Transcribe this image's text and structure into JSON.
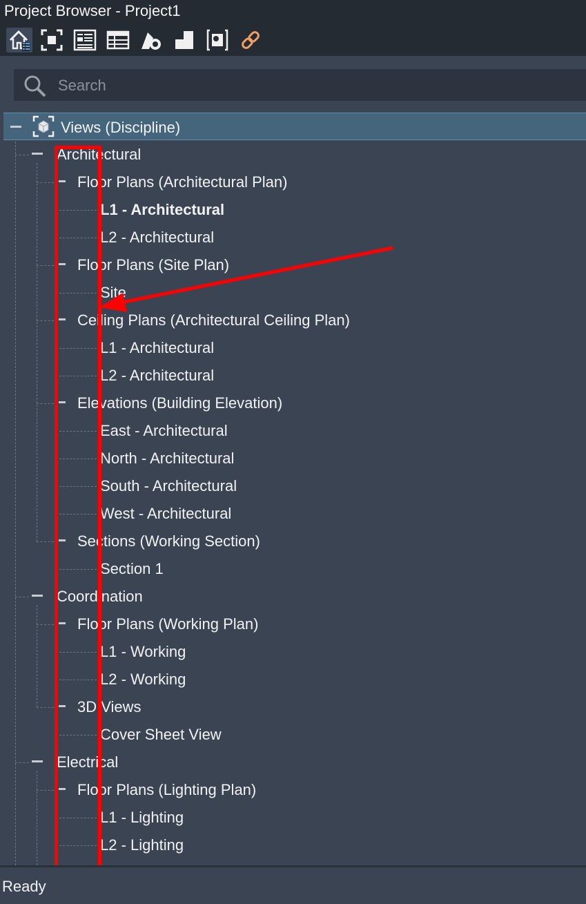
{
  "window": {
    "title": "Project Browser - Project1"
  },
  "toolbar": {
    "buttons": [
      {
        "icon": "home-icon"
      },
      {
        "icon": "views-icon"
      },
      {
        "icon": "sheets-icon"
      },
      {
        "icon": "schedules-icon"
      },
      {
        "icon": "families-icon"
      },
      {
        "icon": "groups-icon"
      },
      {
        "icon": "revit-links-icon"
      },
      {
        "icon": "link-icon"
      }
    ]
  },
  "search": {
    "placeholder": "Search",
    "value": ""
  },
  "tree": {
    "root": "Views (Discipline)",
    "disciplines": [
      {
        "label": "Architectural",
        "groups": [
          {
            "label": "Floor Plans (Architectural Plan)",
            "items": [
              "L1 - Architectural",
              "L2 - Architectural"
            ]
          },
          {
            "label": "Floor Plans (Site Plan)",
            "items": [
              "Site"
            ]
          },
          {
            "label": "Ceiling Plans (Architectural Ceiling Plan)",
            "items": [
              "L1 - Architectural",
              "L2 - Architectural"
            ]
          },
          {
            "label": "Elevations (Building Elevation)",
            "items": [
              "East - Architectural",
              "North - Architectural",
              "South - Architectural",
              "West - Architectural"
            ]
          },
          {
            "label": "Sections (Working Section)",
            "items": [
              "Section 1"
            ]
          }
        ]
      },
      {
        "label": "Coordination",
        "groups": [
          {
            "label": "Floor Plans (Working Plan)",
            "items": [
              "L1 - Working",
              "L2 - Working"
            ]
          },
          {
            "label": "3D Views",
            "items": [
              "Cover Sheet View"
            ]
          }
        ]
      },
      {
        "label": "Electrical",
        "groups": [
          {
            "label": "Floor Plans (Lighting Plan)",
            "items": [
              "L1 - Lighting",
              "L2 - Lighting"
            ]
          }
        ]
      }
    ],
    "active_view": "L1 - Architectural"
  },
  "status": {
    "text": "Ready"
  },
  "colors": {
    "background": "#3b4453",
    "titlebar": "#252b33",
    "selected_row": "#45657c",
    "annotation": "#ff0000"
  }
}
